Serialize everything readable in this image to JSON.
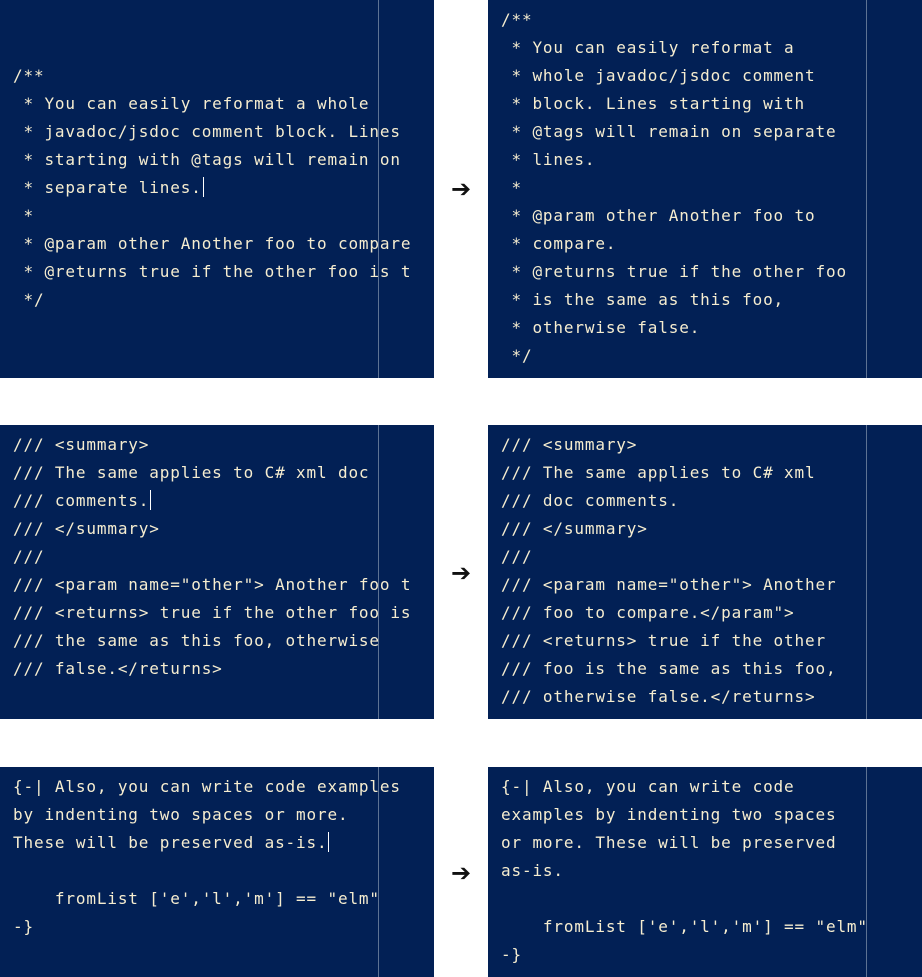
{
  "examples": [
    {
      "before": {
        "lines": [
          "/**",
          " * You can easily reformat a whole",
          " * javadoc/jsdoc comment block. Lines",
          " * starting with @tags will remain on",
          " * separate lines.",
          " *",
          " * @param other Another foo to compare",
          " * @returns true if the other foo is t",
          " */"
        ],
        "cursor_line": 4
      },
      "after": {
        "lines": [
          "/**",
          " * You can easily reformat a",
          " * whole javadoc/jsdoc comment",
          " * block. Lines starting with",
          " * @tags will remain on separate",
          " * lines.",
          " *",
          " * @param other Another foo to",
          " * compare.",
          " * @returns true if the other foo",
          " * is the same as this foo,",
          " * otherwise false.",
          " */"
        ]
      },
      "arrow": "➔"
    },
    {
      "before": {
        "lines": [
          "/// <summary>",
          "/// The same applies to C# xml doc",
          "/// comments.",
          "/// </summary>",
          "///",
          "/// <param name=\"other\"> Another foo t",
          "/// <returns> true if the other foo is",
          "/// the same as this foo, otherwise",
          "/// false.</returns>"
        ],
        "cursor_line": 2
      },
      "after": {
        "lines": [
          "/// <summary>",
          "/// The same applies to C# xml",
          "/// doc comments.",
          "/// </summary>",
          "///",
          "/// <param name=\"other\"> Another",
          "/// foo to compare.</param\">",
          "/// <returns> true if the other",
          "/// foo is the same as this foo,",
          "/// otherwise false.</returns>"
        ]
      },
      "arrow": "➔"
    },
    {
      "before": {
        "lines": [
          "{-| Also, you can write code examples",
          "by indenting two spaces or more.",
          "These will be preserved as-is.",
          "",
          "    fromList ['e','l','m'] == \"elm\"",
          "-}"
        ],
        "cursor_line": 2
      },
      "after": {
        "lines": [
          "{-| Also, you can write code",
          "examples by indenting two spaces",
          "or more. These will be preserved",
          "as-is.",
          "",
          "    fromList ['e','l','m'] == \"elm\"",
          "-}"
        ]
      },
      "arrow": "➔"
    }
  ]
}
